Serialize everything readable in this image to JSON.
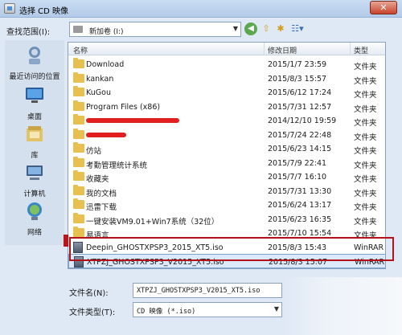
{
  "window": {
    "title": "选择 CD 映像",
    "close_glyph": "✕"
  },
  "lookin": {
    "label": "查找范围(I):",
    "value": "新加卷 (I:)"
  },
  "places": [
    {
      "label": "最近访问的位置",
      "icon": "recent-places-icon"
    },
    {
      "label": "桌面",
      "icon": "desktop-icon"
    },
    {
      "label": "库",
      "icon": "library-icon"
    },
    {
      "label": "计算机",
      "icon": "computer-icon"
    },
    {
      "label": "网络",
      "icon": "network-icon"
    }
  ],
  "columns": {
    "name": "名称",
    "date": "修改日期",
    "type": "类型"
  },
  "files": [
    {
      "name": "Download",
      "date": "2015/1/7 23:59",
      "type": "文件夹",
      "kind": "folder"
    },
    {
      "name": "kankan",
      "date": "2015/8/3 15:57",
      "type": "文件夹",
      "kind": "folder"
    },
    {
      "name": "KuGou",
      "date": "2015/6/12 17:24",
      "type": "文件夹",
      "kind": "folder"
    },
    {
      "name": "Program Files (x86)",
      "date": "2015/7/31 12:57",
      "type": "文件夹",
      "kind": "folder"
    },
    {
      "name": "",
      "date": "2014/12/10 19:59",
      "type": "文件夹",
      "kind": "folder-redacted"
    },
    {
      "name": "",
      "date": "2015/7/24 22:48",
      "type": "文件夹",
      "kind": "folder-redacted"
    },
    {
      "name": "仿站",
      "date": "2015/6/23 14:15",
      "type": "文件夹",
      "kind": "folder"
    },
    {
      "name": "考勤管理统计系统",
      "date": "2015/7/9 22:41",
      "type": "文件夹",
      "kind": "folder"
    },
    {
      "name": "收藏夹",
      "date": "2015/7/7 16:10",
      "type": "文件夹",
      "kind": "folder"
    },
    {
      "name": "我的文档",
      "date": "2015/7/31 13:30",
      "type": "文件夹",
      "kind": "folder"
    },
    {
      "name": "迅雷下载",
      "date": "2015/6/24 13:17",
      "type": "文件夹",
      "kind": "folder"
    },
    {
      "name": "一键安装VM9.01+Win7系统（32位）",
      "date": "2015/6/23 16:35",
      "type": "文件夹",
      "kind": "folder"
    },
    {
      "name": "易语言",
      "date": "2015/7/10 15:54",
      "type": "文件夹",
      "kind": "folder"
    },
    {
      "name": "Deepin_GHOSTXPSP3_2015_XT5.iso",
      "date": "2015/8/3 15:43",
      "type": "WinRAR",
      "kind": "iso"
    },
    {
      "name": "XTPZJ_GHOSTXPSP3_V2015_XT5.iso",
      "date": "2015/8/3 15:07",
      "type": "WinRAR",
      "kind": "iso",
      "selected": true
    }
  ],
  "filename": {
    "label": "文件名(N):",
    "value": "XTPZJ_GHOSTXPSP3_V2015_XT5.iso"
  },
  "filetype": {
    "label": "文件类型(T):",
    "value": "CD 映像 (*.iso)"
  },
  "colors": {
    "highlight": "#b3121a",
    "folder": "#e8c04f",
    "selection": "#dbe9fb"
  }
}
